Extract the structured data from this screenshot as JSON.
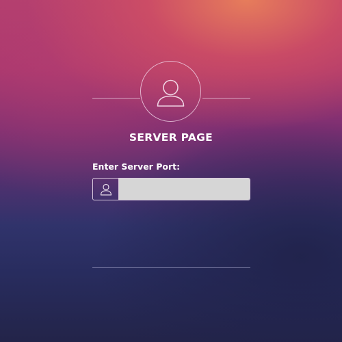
{
  "page": {
    "title": "SERVER PAGE"
  },
  "form": {
    "port_label": "Enter Server Port:",
    "port_value": "",
    "port_placeholder": ""
  },
  "icons": {
    "avatar": "user-icon",
    "input_prefix": "user-icon"
  },
  "colors": {
    "input_background": "#d6d6d6",
    "text": "#ffffff"
  }
}
